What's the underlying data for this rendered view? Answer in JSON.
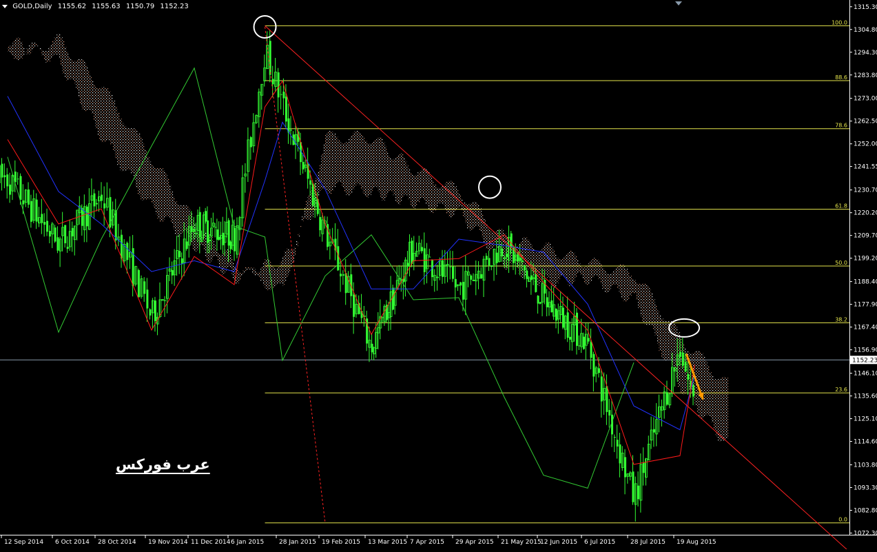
{
  "header": {
    "symbol": "GOLD,Daily",
    "open": "1155.62",
    "high": "1155.63",
    "low": "1150.79",
    "close": "1152.23"
  },
  "watermark": "عرب فوركس",
  "colors": {
    "background": "#000000",
    "candles": "#33ff33",
    "chikou": "#33cc33",
    "tenkan": "#ff1a1a",
    "kijun": "#2233ff",
    "fib": "#e6e64d",
    "trendline": "#ff2222",
    "arrow": "#ff9900",
    "cloud": "#e8a080",
    "current_price_line": "#8899aa"
  },
  "chart_data": {
    "type": "candlestick",
    "title": "GOLD,Daily",
    "ylim": [
      1071.5,
      1316.5
    ],
    "y_ticks": [
      "1315.30",
      "1304.80",
      "1294.30",
      "1283.80",
      "1273.00",
      "1262.50",
      "1252.00",
      "1241.55",
      "1230.70",
      "1220.20",
      "1209.70",
      "1199.20",
      "1188.40",
      "1177.90",
      "1167.40",
      "1156.90",
      "1146.10",
      "1135.60",
      "1125.10",
      "1114.60",
      "1103.80",
      "1093.30",
      "1082.80",
      "1072.30"
    ],
    "x_labels": [
      "12 Sep 2014",
      "6 Oct 2014",
      "28 Oct 2014",
      "19 Nov 2014",
      "11 Dec 2014",
      "6 Jan 2015",
      "28 Jan 2015",
      "19 Feb 2015",
      "13 Mar 2015",
      "7 Apr 2015",
      "29 Apr 2015",
      "21 May 2015",
      "12 Jun 2015",
      "6 Jul 2015",
      "28 Jul 2015",
      "19 Aug 2015"
    ],
    "current_price": "1152.23",
    "fibonacci": {
      "levels": [
        {
          "label": "100.0",
          "price": 1306.5
        },
        {
          "label": "88.6",
          "price": 1281.2
        },
        {
          "label": "78.6",
          "price": 1259.0
        },
        {
          "label": "61.8",
          "price": 1221.8
        },
        {
          "label": "50.0",
          "price": 1195.6
        },
        {
          "label": "38.2",
          "price": 1169.4
        },
        {
          "label": "23.6",
          "price": 1137.0
        },
        {
          "label": "0.0",
          "price": 1077.0
        }
      ],
      "start_label": "20 Jan 2015"
    },
    "trendline": {
      "from": {
        "date": "20 Jan 2015",
        "price": 1306.5
      },
      "to": {
        "date": "11 Sep 2015",
        "price": 1114.0
      }
    },
    "tenkan_line": [
      [
        "12 Sep 2014",
        1254
      ],
      [
        "6 Oct 2014",
        1215
      ],
      [
        "28 Oct 2014",
        1222
      ],
      [
        "19 Nov 2014",
        1166
      ],
      [
        "11 Dec 2014",
        1200
      ],
      [
        "6 Jan 2015",
        1187
      ],
      [
        "20 Jan 2015",
        1269
      ],
      [
        "28 Jan 2015",
        1281
      ],
      [
        "19 Feb 2015",
        1215
      ],
      [
        "13 Mar 2015",
        1164
      ],
      [
        "7 Apr 2015",
        1198
      ],
      [
        "29 Apr 2015",
        1199
      ],
      [
        "21 May 2015",
        1210
      ],
      [
        "12 Jun 2015",
        1188
      ],
      [
        "6 Jul 2015",
        1166
      ],
      [
        "28 Jul 2015",
        1104
      ],
      [
        "19 Aug 2015",
        1108
      ],
      [
        "26 Aug 2015",
        1150
      ]
    ],
    "kijun_line": [
      [
        "12 Sep 2014",
        1274
      ],
      [
        "6 Oct 2014",
        1230
      ],
      [
        "28 Oct 2014",
        1215
      ],
      [
        "19 Nov 2014",
        1193
      ],
      [
        "11 Dec 2014",
        1198
      ],
      [
        "6 Jan 2015",
        1193
      ],
      [
        "20 Jan 2015",
        1235
      ],
      [
        "28 Jan 2015",
        1262
      ],
      [
        "19 Feb 2015",
        1231
      ],
      [
        "13 Mar 2015",
        1185
      ],
      [
        "7 Apr 2015",
        1185
      ],
      [
        "29 Apr 2015",
        1208
      ],
      [
        "21 May 2015",
        1205
      ],
      [
        "12 Jun 2015",
        1202
      ],
      [
        "6 Jul 2015",
        1178
      ],
      [
        "28 Jul 2015",
        1131
      ],
      [
        "19 Aug 2015",
        1120
      ],
      [
        "26 Aug 2015",
        1145
      ]
    ],
    "chikou_line": [
      [
        "12 Sep 2014",
        1246
      ],
      [
        "6 Oct 2014",
        1165
      ],
      [
        "28 Oct 2014",
        1208
      ],
      [
        "19 Nov 2014",
        1251
      ],
      [
        "11 Dec 2014",
        1287
      ],
      [
        "6 Jan 2015",
        1214
      ],
      [
        "20 Jan 2015",
        1209
      ],
      [
        "28 Jan 2015",
        1152
      ],
      [
        "19 Feb 2015",
        1191
      ],
      [
        "13 Mar 2015",
        1210
      ],
      [
        "7 Apr 2015",
        1180
      ],
      [
        "29 Apr 2015",
        1181
      ],
      [
        "21 May 2015",
        1135
      ],
      [
        "12 Jun 2015",
        1099
      ],
      [
        "6 Jul 2015",
        1093
      ],
      [
        "28 Jul 2015",
        1151
      ]
    ],
    "cloud": [
      [
        "12 Sep 2014",
        1300,
        1292
      ],
      [
        "6 Oct 2014",
        1290,
        1300
      ],
      [
        "28 Oct 2014",
        1255,
        1278
      ],
      [
        "19 Nov 2014",
        1222,
        1245
      ],
      [
        "11 Dec 2014",
        1205,
        1215
      ],
      [
        "6 Jan 2015",
        1190,
        1197
      ],
      [
        "20 Jan 2015",
        1196,
        1188
      ],
      [
        "28 Jan 2015",
        1198,
        1184
      ],
      [
        "19 Feb 2015",
        1232,
        1255
      ],
      [
        "13 Mar 2015",
        1230,
        1255
      ],
      [
        "7 Apr 2015",
        1225,
        1240
      ],
      [
        "29 Apr 2015",
        1220,
        1230
      ],
      [
        "21 May 2015",
        1197,
        1208
      ],
      [
        "12 Jun 2015",
        1188,
        1204
      ],
      [
        "6 Jul 2015",
        1190,
        1197
      ],
      [
        "28 Jul 2015",
        1180,
        1192
      ],
      [
        "19 Aug 2015",
        1140,
        1162
      ],
      [
        "11 Sep 2015",
        1112,
        1140
      ]
    ],
    "price_path": [
      [
        "12 Sep 2014",
        1236
      ],
      [
        "6 Oct 2014",
        1206
      ],
      [
        "28 Oct 2014",
        1228
      ],
      [
        "19 Nov 2014",
        1172
      ],
      [
        "11 Dec 2014",
        1215
      ],
      [
        "6 Jan 2015",
        1209
      ],
      [
        "20 Jan 2015",
        1295
      ],
      [
        "28 Jan 2015",
        1270
      ],
      [
        "19 Feb 2015",
        1211
      ],
      [
        "13 Mar 2015",
        1158
      ],
      [
        "7 Apr 2015",
        1204
      ],
      [
        "29 Apr 2015",
        1185
      ],
      [
        "21 May 2015",
        1206
      ],
      [
        "12 Jun 2015",
        1180
      ],
      [
        "6 Jul 2015",
        1160
      ],
      [
        "28 Jul 2015",
        1088
      ],
      [
        "19 Aug 2015",
        1158
      ],
      [
        "26 Aug 2015",
        1130
      ]
    ],
    "annotations": [
      {
        "type": "circle",
        "date": "20 Jan 2015",
        "price": 1306
      },
      {
        "type": "circle",
        "date": "14 May 2015",
        "price": 1232
      },
      {
        "type": "ellipse",
        "date": "21 Aug 2015",
        "price": 1167
      },
      {
        "type": "arrow",
        "from": {
          "date": "22 Aug 2015",
          "price": 1155
        },
        "to": {
          "date": "30 Aug 2015",
          "price": 1134
        }
      }
    ],
    "dashed_red_line": {
      "from": {
        "date": "20 Jan 2015",
        "price": 1306
      },
      "to": {
        "date": "19 Feb 2015",
        "price": 1077
      }
    }
  }
}
